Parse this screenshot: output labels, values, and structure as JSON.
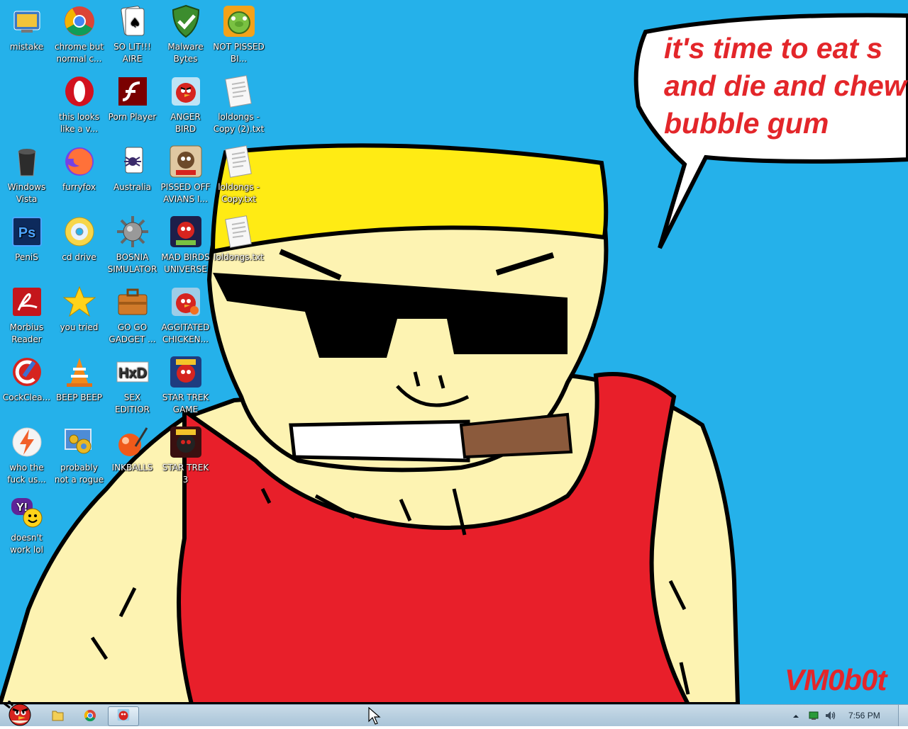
{
  "wallpaper": {
    "speech": [
      "it's time to eat s",
      "and die and chew",
      "bubble gum"
    ],
    "signature": "VM0b0t",
    "colors": {
      "sky": "#25b1ea",
      "hat": "#ffeb14",
      "skin": "#fdf3b2",
      "shirt": "#e81f2a",
      "cigar": "#8b5a3c",
      "text": "#e3262a"
    }
  },
  "desktop_icons": [
    {
      "label": "mistake",
      "icon": "system-control-panel-icon"
    },
    {
      "label": "chrome but normal c...",
      "icon": "chrome-icon"
    },
    {
      "label": "SO LIT!!! AIRE",
      "icon": "solitaire-cards-icon"
    },
    {
      "label": "Malware Bytes",
      "icon": "shield-check-icon"
    },
    {
      "label": "NOT PISSED BI...",
      "icon": "green-pig-icon"
    },
    {
      "label": "this looks like a v...",
      "icon": "opera-icon"
    },
    {
      "label": "Porn Player",
      "icon": "flash-player-icon"
    },
    {
      "label": "ANGER BIRD",
      "icon": "angry-bird-icon"
    },
    {
      "label": "loldongs - Copy (2).txt",
      "icon": "text-file-icon"
    },
    {
      "label": "Windows Vista",
      "icon": "recycle-bin-icon"
    },
    {
      "label": "furryfox",
      "icon": "firefox-icon"
    },
    {
      "label": "Australia",
      "icon": "spider-solitaire-icon"
    },
    {
      "label": "PISSED OFF AVIANS I...",
      "icon": "angry-birds-seasons-icon"
    },
    {
      "label": "loldongs - Copy.txt",
      "icon": "text-file-icon"
    },
    {
      "label": "PeniS",
      "icon": "photoshop-icon"
    },
    {
      "label": "cd drive",
      "icon": "cd-disc-icon"
    },
    {
      "label": "BOSNIA SIMULATOR",
      "icon": "spiked-mine-icon"
    },
    {
      "label": "MAD BIRDS UNIVERSE",
      "icon": "angry-birds-space-icon"
    },
    {
      "label": "loldongs.txt",
      "icon": "text-file-icon"
    },
    {
      "label": "Morbius Reader",
      "icon": "adobe-reader-icon"
    },
    {
      "label": "you tried",
      "icon": "star-icon"
    },
    {
      "label": "GO GO GADGET ...",
      "icon": "briefcase-icon"
    },
    {
      "label": "AGGITATED CHICKEN...",
      "icon": "angry-bird-icon"
    },
    {
      "label": "CockClea...",
      "icon": "ccleaner-icon"
    },
    {
      "label": "BEEP BEEP",
      "icon": "vlc-cone-icon"
    },
    {
      "label": "SEX EDITIOR",
      "icon": "hxd-editor-icon"
    },
    {
      "label": "STAR TREK GAME",
      "icon": "angry-birds-star-wars-icon"
    },
    {
      "label": "who the fuck us...",
      "icon": "lightning-app-icon"
    },
    {
      "label": "probably not a rogue",
      "icon": "gears-monitor-icon"
    },
    {
      "label": "INKBALLS",
      "icon": "inkball-icon"
    },
    {
      "label": "STAR TREK 3",
      "icon": "angry-birds-star-wars-icon"
    },
    {
      "label": "doesn't work lol",
      "icon": "yahoo-messenger-icon"
    }
  ],
  "taskbar": {
    "start_icon": "angry-bird-start-icon",
    "pinned": [
      "folder-icon",
      "chrome-icon",
      "angry-bird-icon"
    ],
    "tray_icons": [
      "show-hidden-arrow-icon",
      "network-icon",
      "volume-icon"
    ],
    "clock": "7:56 PM"
  }
}
